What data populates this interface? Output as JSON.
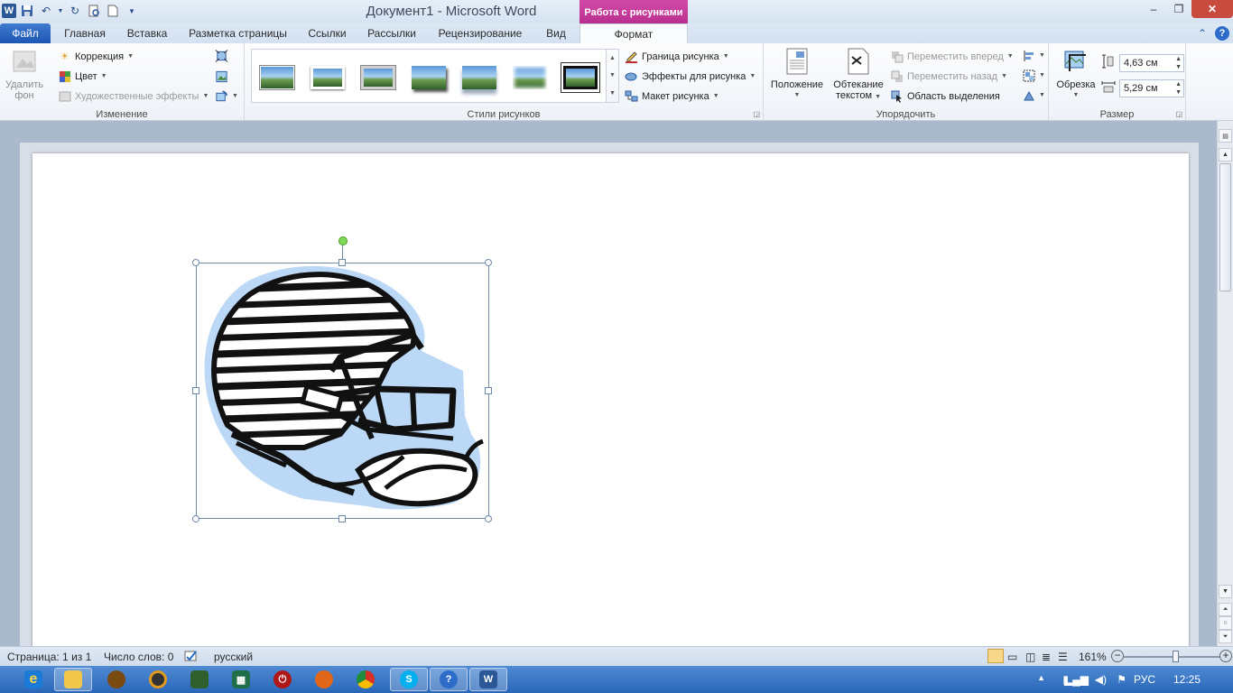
{
  "window": {
    "title": "Документ1  -  Microsoft Word",
    "context_tab_header": "Работа с рисунками",
    "controls": {
      "minimize": "–",
      "maximize": "❐",
      "close": "✕"
    }
  },
  "quick_access": {
    "app_icon": "W"
  },
  "tabs": [
    {
      "label": "Файл"
    },
    {
      "label": "Главная"
    },
    {
      "label": "Вставка"
    },
    {
      "label": "Разметка страницы"
    },
    {
      "label": "Ссылки"
    },
    {
      "label": "Рассылки"
    },
    {
      "label": "Рецензирование"
    },
    {
      "label": "Вид"
    },
    {
      "label": "Формат"
    }
  ],
  "ribbon": {
    "change": {
      "label": "Изменение",
      "remove_bg_line1": "Удалить",
      "remove_bg_line2": "фон",
      "correction": "Коррекция",
      "color": "Цвет",
      "art_effects": "Художественные эффекты"
    },
    "styles": {
      "label": "Стили рисунков",
      "border": "Граница рисунка",
      "effects": "Эффекты для рисунка",
      "layout": "Макет рисунка"
    },
    "arrange": {
      "label": "Упорядочить",
      "position": "Положение",
      "wrap_line1": "Обтекание",
      "wrap_line2": "текстом",
      "bring_forward": "Переместить вперед",
      "send_backward": "Переместить назад",
      "selection_pane": "Область выделения"
    },
    "size": {
      "label": "Размер",
      "crop": "Обрезка",
      "height": "4,63 см",
      "width": "5,29 см"
    }
  },
  "status": {
    "page": "Страница: 1 из 1",
    "words": "Число слов: 0",
    "language": "русский",
    "zoom": "161%",
    "zoom_out": "−",
    "zoom_in": "+"
  },
  "tray": {
    "lang": "РУС",
    "time": "12:25"
  },
  "colors": {
    "accent": "#2b5797",
    "context_tab": "#c63a9c",
    "helmet_outline": "#b9d7f7"
  }
}
